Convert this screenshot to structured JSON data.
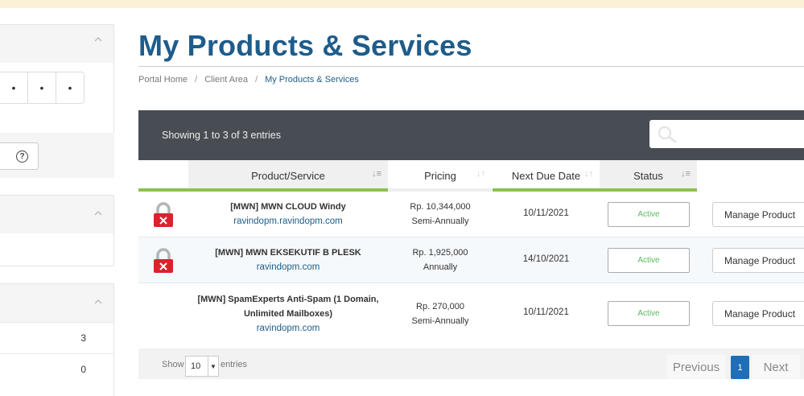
{
  "page": {
    "title": "My Products & Services"
  },
  "breadcrumb": {
    "items": [
      "Portal Home",
      "Client Area",
      "My Products & Services"
    ],
    "separator": "/"
  },
  "sidebar": {
    "dots": [
      "•",
      "•",
      "•"
    ],
    "help_icon": "?",
    "counts": [
      "3",
      "0"
    ]
  },
  "table": {
    "showing": "Showing 1 to 3 of 3 entries",
    "search_placeholder": "",
    "columns": [
      "Product/Service",
      "Pricing",
      "Next Due Date",
      "Status"
    ],
    "rows": [
      {
        "name": "[MWN] MWN CLOUD Windy",
        "domain": "ravindopm.ravindopm.com",
        "price": "Rp. 10,344,000",
        "cycle": "Semi-Annually",
        "due": "10/11/2021",
        "status": "Active",
        "action": "Manage Product"
      },
      {
        "name": "[MWN] MWN EKSEKUTIF B PLESK",
        "domain": "ravindopm.com",
        "price": "Rp. 1,925,000",
        "cycle": "Annually",
        "due": "14/10/2021",
        "status": "Active",
        "action": "Manage Product"
      },
      {
        "name_line1": "[MWN] SpamExperts Anti-Spam (1 Domain,",
        "name_line2": "Unlimited Mailboxes)",
        "domain": "ravindopm.com",
        "price": "Rp. 270,000",
        "cycle": "Semi-Annually",
        "due": "10/11/2021",
        "status": "Active",
        "action": "Manage Product"
      }
    ]
  },
  "footer": {
    "show_label": "Show",
    "length_value": "10",
    "entries_label": "entries",
    "prev": "Previous",
    "page": "1",
    "next": "Next"
  },
  "colors": {
    "accent": "#1e5c8b",
    "header_bar": "#484c53",
    "green": "#8bc34a",
    "active": "#5cb85c",
    "lock_red": "#d9232d",
    "page_active": "#1e6fb8"
  },
  "icons": {
    "search": "search-icon",
    "lock": "lock-icon",
    "help": "help-icon",
    "chevron": "chevron-up-icon",
    "sort": "sort-icon"
  }
}
